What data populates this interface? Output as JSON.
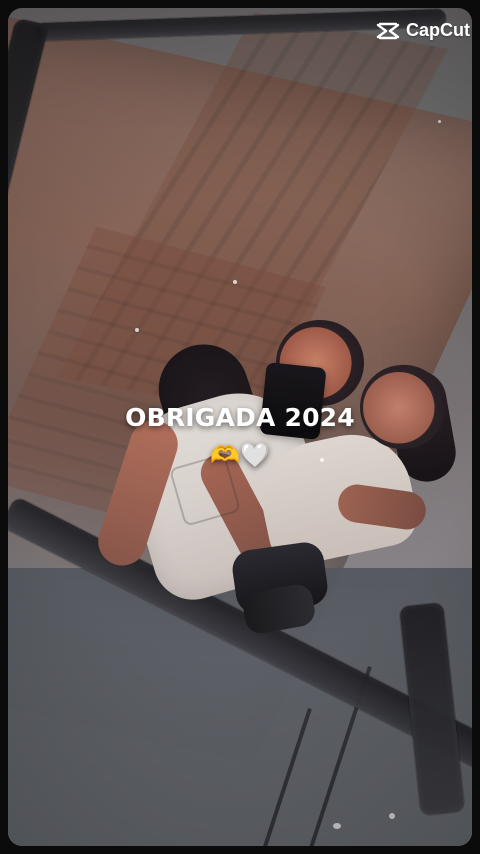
{
  "watermark": {
    "text": "CapCut",
    "icon": "capcut-icon"
  },
  "caption": {
    "title": "OBRIGADA 2024",
    "emoji": "🫶🤍"
  },
  "colors": {
    "background": "#0b0b0c",
    "text": "#ffffff"
  }
}
